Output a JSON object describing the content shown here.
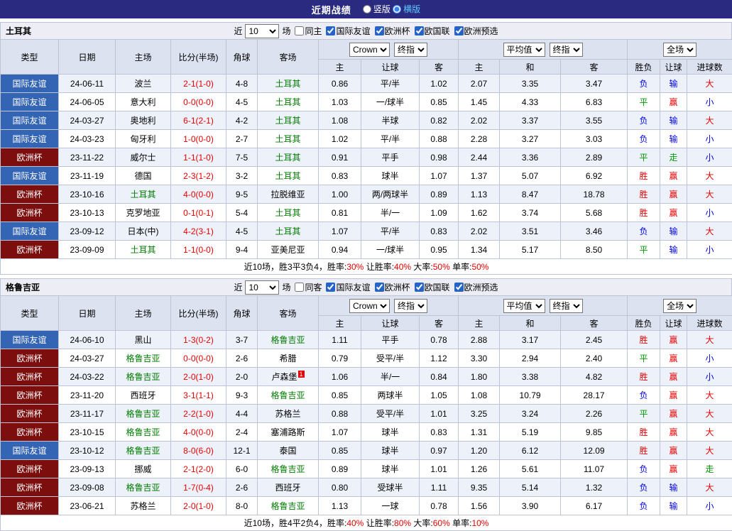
{
  "topbar": {
    "title": "近期战绩",
    "layout_options": [
      {
        "label": "竖版",
        "selected": false
      },
      {
        "label": "横版",
        "selected": true
      }
    ]
  },
  "table_header": {
    "static_cols": [
      "类型",
      "日期",
      "主场",
      "比分(半场)",
      "角球",
      "客场"
    ],
    "asia_group": {
      "bookmaker_select": "Crown",
      "stage_select": "终指",
      "cols": [
        "主",
        "让球",
        "客"
      ]
    },
    "europe_group": {
      "bookmaker_select": "平均值",
      "stage_select": "终指",
      "cols": [
        "主",
        "和",
        "客"
      ]
    },
    "result_group": {
      "scope_select": "全场",
      "cols": [
        "胜负",
        "让球",
        "进球数"
      ]
    }
  },
  "sections": [
    {
      "team": "土耳其",
      "filter": {
        "near_label": "近",
        "count": "10",
        "matches_label": "场",
        "venue": {
          "label": "同主",
          "checked": false
        },
        "competitions": [
          {
            "label": "国际友谊",
            "checked": true
          },
          {
            "label": "欧洲杯",
            "checked": true
          },
          {
            "label": "欧国联",
            "checked": true
          },
          {
            "label": "欧洲预选",
            "checked": true
          }
        ]
      },
      "rows": [
        {
          "comp": "国际友谊",
          "comp_color": "blue",
          "date": "24-06-11",
          "home": "波兰",
          "home_focus": false,
          "score": "2-1(1-0)",
          "corners": "4-8",
          "away": "土耳其",
          "away_focus": true,
          "away_badge": "",
          "asia": [
            "0.86",
            "平/半",
            "1.02"
          ],
          "europe": [
            "2.07",
            "3.35",
            "3.47"
          ],
          "results": [
            {
              "text": "负",
              "color": "blue"
            },
            {
              "text": "输",
              "color": "blue"
            },
            {
              "text": "大",
              "color": "red"
            }
          ]
        },
        {
          "comp": "国际友谊",
          "comp_color": "blue",
          "date": "24-06-05",
          "home": "意大利",
          "home_focus": false,
          "score": "0-0(0-0)",
          "corners": "4-5",
          "away": "土耳其",
          "away_focus": true,
          "away_badge": "",
          "asia": [
            "1.03",
            "一/球半",
            "0.85"
          ],
          "europe": [
            "1.45",
            "4.33",
            "6.83"
          ],
          "results": [
            {
              "text": "平",
              "color": "green"
            },
            {
              "text": "赢",
              "color": "red"
            },
            {
              "text": "小",
              "color": "blue"
            }
          ]
        },
        {
          "comp": "国际友谊",
          "comp_color": "blue",
          "date": "24-03-27",
          "home": "奥地利",
          "home_focus": false,
          "score": "6-1(2-1)",
          "corners": "4-2",
          "away": "土耳其",
          "away_focus": true,
          "away_badge": "",
          "asia": [
            "1.08",
            "半球",
            "0.82"
          ],
          "europe": [
            "2.02",
            "3.37",
            "3.55"
          ],
          "results": [
            {
              "text": "负",
              "color": "blue"
            },
            {
              "text": "输",
              "color": "blue"
            },
            {
              "text": "大",
              "color": "red"
            }
          ]
        },
        {
          "comp": "国际友谊",
          "comp_color": "blue",
          "date": "24-03-23",
          "home": "匈牙利",
          "home_focus": false,
          "score": "1-0(0-0)",
          "corners": "2-7",
          "away": "土耳其",
          "away_focus": true,
          "away_badge": "",
          "asia": [
            "1.02",
            "平/半",
            "0.88"
          ],
          "europe": [
            "2.28",
            "3.27",
            "3.03"
          ],
          "results": [
            {
              "text": "负",
              "color": "blue"
            },
            {
              "text": "输",
              "color": "blue"
            },
            {
              "text": "小",
              "color": "blue"
            }
          ]
        },
        {
          "comp": "欧洲杯",
          "comp_color": "maroon",
          "date": "23-11-22",
          "home": "威尔士",
          "home_focus": false,
          "score": "1-1(1-0)",
          "corners": "7-5",
          "away": "土耳其",
          "away_focus": true,
          "away_badge": "",
          "asia": [
            "0.91",
            "平手",
            "0.98"
          ],
          "europe": [
            "2.44",
            "3.36",
            "2.89"
          ],
          "results": [
            {
              "text": "平",
              "color": "green"
            },
            {
              "text": "走",
              "color": "green"
            },
            {
              "text": "小",
              "color": "blue"
            }
          ]
        },
        {
          "comp": "国际友谊",
          "comp_color": "blue",
          "date": "23-11-19",
          "home": "德国",
          "home_focus": false,
          "score": "2-3(1-2)",
          "corners": "3-2",
          "away": "土耳其",
          "away_focus": true,
          "away_badge": "",
          "asia": [
            "0.83",
            "球半",
            "1.07"
          ],
          "europe": [
            "1.37",
            "5.07",
            "6.92"
          ],
          "results": [
            {
              "text": "胜",
              "color": "red"
            },
            {
              "text": "赢",
              "color": "red"
            },
            {
              "text": "大",
              "color": "red"
            }
          ]
        },
        {
          "comp": "欧洲杯",
          "comp_color": "maroon",
          "date": "23-10-16",
          "home": "土耳其",
          "home_focus": true,
          "score": "4-0(0-0)",
          "corners": "9-5",
          "away": "拉脱维亚",
          "away_focus": false,
          "away_badge": "",
          "asia": [
            "1.00",
            "两/两球半",
            "0.89"
          ],
          "europe": [
            "1.13",
            "8.47",
            "18.78"
          ],
          "results": [
            {
              "text": "胜",
              "color": "red"
            },
            {
              "text": "赢",
              "color": "red"
            },
            {
              "text": "大",
              "color": "red"
            }
          ]
        },
        {
          "comp": "欧洲杯",
          "comp_color": "maroon",
          "date": "23-10-13",
          "home": "克罗地亚",
          "home_focus": false,
          "score": "0-1(0-1)",
          "corners": "5-4",
          "away": "土耳其",
          "away_focus": true,
          "away_badge": "",
          "asia": [
            "0.81",
            "半/一",
            "1.09"
          ],
          "europe": [
            "1.62",
            "3.74",
            "5.68"
          ],
          "results": [
            {
              "text": "胜",
              "color": "red"
            },
            {
              "text": "赢",
              "color": "red"
            },
            {
              "text": "小",
              "color": "blue"
            }
          ]
        },
        {
          "comp": "国际友谊",
          "comp_color": "blue",
          "date": "23-09-12",
          "home": "日本(中)",
          "home_focus": false,
          "score": "4-2(3-1)",
          "corners": "4-5",
          "away": "土耳其",
          "away_focus": true,
          "away_badge": "",
          "asia": [
            "1.07",
            "平/半",
            "0.83"
          ],
          "europe": [
            "2.02",
            "3.51",
            "3.46"
          ],
          "results": [
            {
              "text": "负",
              "color": "blue"
            },
            {
              "text": "输",
              "color": "blue"
            },
            {
              "text": "大",
              "color": "red"
            }
          ]
        },
        {
          "comp": "欧洲杯",
          "comp_color": "maroon",
          "date": "23-09-09",
          "home": "土耳其",
          "home_focus": true,
          "score": "1-1(0-0)",
          "corners": "9-4",
          "away": "亚美尼亚",
          "away_focus": false,
          "away_badge": "",
          "asia": [
            "0.94",
            "一/球半",
            "0.95"
          ],
          "europe": [
            "1.34",
            "5.17",
            "8.50"
          ],
          "results": [
            {
              "text": "平",
              "color": "green"
            },
            {
              "text": "输",
              "color": "blue"
            },
            {
              "text": "小",
              "color": "blue"
            }
          ]
        }
      ],
      "summary": [
        {
          "text": "近10场，胜3平3负4，胜率:",
          "color": "dark"
        },
        {
          "text": "30%",
          "color": "red"
        },
        {
          "text": " 让胜率:",
          "color": "dark"
        },
        {
          "text": "40%",
          "color": "red"
        },
        {
          "text": " 大率:",
          "color": "dark"
        },
        {
          "text": "50%",
          "color": "red"
        },
        {
          "text": " 单率:",
          "color": "dark"
        },
        {
          "text": "50%",
          "color": "red"
        }
      ]
    },
    {
      "team": "格鲁吉亚",
      "filter": {
        "near_label": "近",
        "count": "10",
        "matches_label": "场",
        "venue": {
          "label": "同客",
          "checked": false
        },
        "competitions": [
          {
            "label": "国际友谊",
            "checked": true
          },
          {
            "label": "欧洲杯",
            "checked": true
          },
          {
            "label": "欧国联",
            "checked": true
          },
          {
            "label": "欧洲预选",
            "checked": true
          }
        ]
      },
      "rows": [
        {
          "comp": "国际友谊",
          "comp_color": "blue",
          "date": "24-06-10",
          "home": "黑山",
          "home_focus": false,
          "score": "1-3(0-2)",
          "corners": "3-7",
          "away": "格鲁吉亚",
          "away_focus": true,
          "away_badge": "",
          "asia": [
            "1.11",
            "平手",
            "0.78"
          ],
          "europe": [
            "2.88",
            "3.17",
            "2.45"
          ],
          "results": [
            {
              "text": "胜",
              "color": "red"
            },
            {
              "text": "赢",
              "color": "red"
            },
            {
              "text": "大",
              "color": "red"
            }
          ]
        },
        {
          "comp": "欧洲杯",
          "comp_color": "maroon",
          "date": "24-03-27",
          "home": "格鲁吉亚",
          "home_focus": true,
          "score": "0-0(0-0)",
          "corners": "2-6",
          "away": "希腊",
          "away_focus": false,
          "away_badge": "",
          "asia": [
            "0.79",
            "受平/半",
            "1.12"
          ],
          "europe": [
            "3.30",
            "2.94",
            "2.40"
          ],
          "results": [
            {
              "text": "平",
              "color": "green"
            },
            {
              "text": "赢",
              "color": "red"
            },
            {
              "text": "小",
              "color": "blue"
            }
          ]
        },
        {
          "comp": "欧洲杯",
          "comp_color": "maroon",
          "date": "24-03-22",
          "home": "格鲁吉亚",
          "home_focus": true,
          "score": "2-0(1-0)",
          "corners": "2-0",
          "away": "卢森堡",
          "away_focus": false,
          "away_badge": "1",
          "asia": [
            "1.06",
            "半/一",
            "0.84"
          ],
          "europe": [
            "1.80",
            "3.38",
            "4.82"
          ],
          "results": [
            {
              "text": "胜",
              "color": "red"
            },
            {
              "text": "赢",
              "color": "red"
            },
            {
              "text": "小",
              "color": "blue"
            }
          ]
        },
        {
          "comp": "欧洲杯",
          "comp_color": "maroon",
          "date": "23-11-20",
          "home": "西班牙",
          "home_focus": false,
          "score": "3-1(1-1)",
          "corners": "9-3",
          "away": "格鲁吉亚",
          "away_focus": true,
          "away_badge": "",
          "asia": [
            "0.85",
            "两球半",
            "1.05"
          ],
          "europe": [
            "1.08",
            "10.79",
            "28.17"
          ],
          "results": [
            {
              "text": "负",
              "color": "blue"
            },
            {
              "text": "赢",
              "color": "red"
            },
            {
              "text": "大",
              "color": "red"
            }
          ]
        },
        {
          "comp": "欧洲杯",
          "comp_color": "maroon",
          "date": "23-11-17",
          "home": "格鲁吉亚",
          "home_focus": true,
          "score": "2-2(1-0)",
          "corners": "4-4",
          "away": "苏格兰",
          "away_focus": false,
          "away_badge": "",
          "asia": [
            "0.88",
            "受平/半",
            "1.01"
          ],
          "europe": [
            "3.25",
            "3.24",
            "2.26"
          ],
          "results": [
            {
              "text": "平",
              "color": "green"
            },
            {
              "text": "赢",
              "color": "red"
            },
            {
              "text": "大",
              "color": "red"
            }
          ]
        },
        {
          "comp": "欧洲杯",
          "comp_color": "maroon",
          "date": "23-10-15",
          "home": "格鲁吉亚",
          "home_focus": true,
          "score": "4-0(0-0)",
          "corners": "2-4",
          "away": "塞浦路斯",
          "away_focus": false,
          "away_badge": "",
          "asia": [
            "1.07",
            "球半",
            "0.83"
          ],
          "europe": [
            "1.31",
            "5.19",
            "9.85"
          ],
          "results": [
            {
              "text": "胜",
              "color": "red"
            },
            {
              "text": "赢",
              "color": "red"
            },
            {
              "text": "大",
              "color": "red"
            }
          ]
        },
        {
          "comp": "国际友谊",
          "comp_color": "blue",
          "date": "23-10-12",
          "home": "格鲁吉亚",
          "home_focus": true,
          "score": "8-0(6-0)",
          "corners": "12-1",
          "away": "泰国",
          "away_focus": false,
          "away_badge": "",
          "asia": [
            "0.85",
            "球半",
            "0.97"
          ],
          "europe": [
            "1.20",
            "6.12",
            "12.09"
          ],
          "results": [
            {
              "text": "胜",
              "color": "red"
            },
            {
              "text": "赢",
              "color": "red"
            },
            {
              "text": "大",
              "color": "red"
            }
          ]
        },
        {
          "comp": "欧洲杯",
          "comp_color": "maroon",
          "date": "23-09-13",
          "home": "挪威",
          "home_focus": false,
          "score": "2-1(2-0)",
          "corners": "6-0",
          "away": "格鲁吉亚",
          "away_focus": true,
          "away_badge": "",
          "asia": [
            "0.89",
            "球半",
            "1.01"
          ],
          "europe": [
            "1.26",
            "5.61",
            "11.07"
          ],
          "results": [
            {
              "text": "负",
              "color": "blue"
            },
            {
              "text": "赢",
              "color": "red"
            },
            {
              "text": "走",
              "color": "green"
            }
          ]
        },
        {
          "comp": "欧洲杯",
          "comp_color": "maroon",
          "date": "23-09-08",
          "home": "格鲁吉亚",
          "home_focus": true,
          "score": "1-7(0-4)",
          "corners": "2-6",
          "away": "西班牙",
          "away_focus": false,
          "away_badge": "",
          "asia": [
            "0.80",
            "受球半",
            "1.11"
          ],
          "europe": [
            "9.35",
            "5.14",
            "1.32"
          ],
          "results": [
            {
              "text": "负",
              "color": "blue"
            },
            {
              "text": "输",
              "color": "blue"
            },
            {
              "text": "大",
              "color": "red"
            }
          ]
        },
        {
          "comp": "欧洲杯",
          "comp_color": "maroon",
          "date": "23-06-21",
          "home": "苏格兰",
          "home_focus": false,
          "score": "2-0(1-0)",
          "corners": "8-0",
          "away": "格鲁吉亚",
          "away_focus": true,
          "away_badge": "",
          "asia": [
            "1.13",
            "一球",
            "0.78"
          ],
          "europe": [
            "1.56",
            "3.90",
            "6.17"
          ],
          "results": [
            {
              "text": "负",
              "color": "blue"
            },
            {
              "text": "输",
              "color": "blue"
            },
            {
              "text": "小",
              "color": "blue"
            }
          ]
        }
      ],
      "summary": [
        {
          "text": "近10场，胜4平2负4，胜率:",
          "color": "dark"
        },
        {
          "text": "40%",
          "color": "red"
        },
        {
          "text": " 让胜率:",
          "color": "dark"
        },
        {
          "text": "80%",
          "color": "red"
        },
        {
          "text": " 大率:",
          "color": "dark"
        },
        {
          "text": "60%",
          "color": "red"
        },
        {
          "text": " 单率:",
          "color": "dark"
        },
        {
          "text": "10%",
          "color": "red"
        }
      ]
    }
  ]
}
